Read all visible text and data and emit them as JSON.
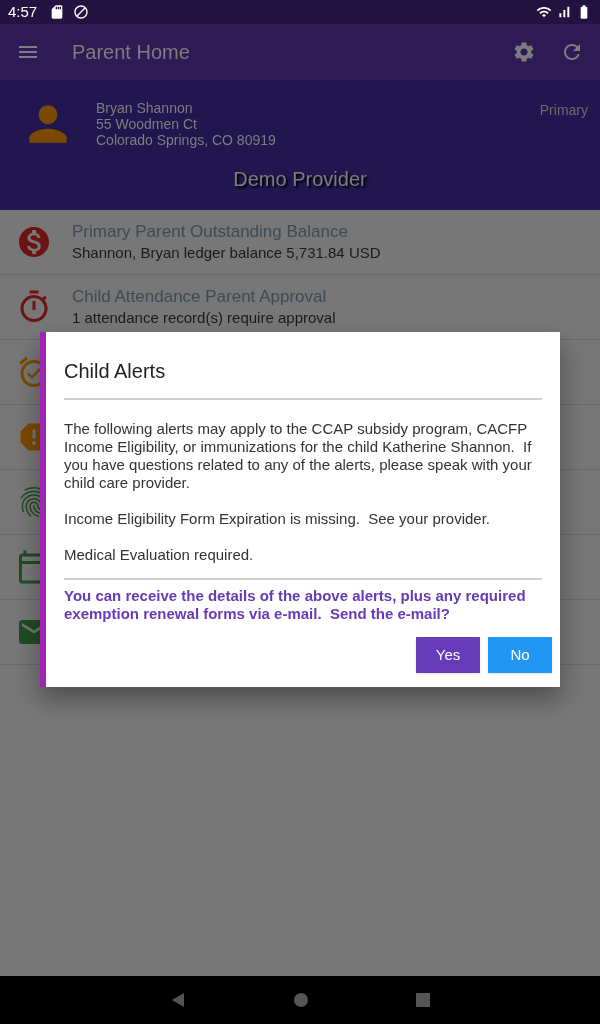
{
  "status_bar": {
    "time": "4:57"
  },
  "toolbar": {
    "title": "Parent Home"
  },
  "parent": {
    "name": "Bryan Shannon",
    "address_line_1": "55 Woodmen Ct",
    "address_line_2": "Colorado Springs, CO 80919",
    "role": "Primary"
  },
  "provider": "Demo Provider",
  "rows": [
    {
      "kind": "balance",
      "title": "Primary Parent Outstanding Balance",
      "subtitle": "Shannon, Bryan ledger balance 5,731.84 USD"
    },
    {
      "kind": "attendance",
      "title": "Child Attendance Parent Approval",
      "subtitle": "1 attendance record(s) require approval"
    },
    {
      "kind": "alarm"
    },
    {
      "kind": "alert"
    },
    {
      "kind": "fingerprint"
    },
    {
      "kind": "calendar"
    },
    {
      "kind": "mail"
    }
  ],
  "dialog": {
    "title": "Child Alerts",
    "paragraphs": [
      "The following alerts may apply to the CCAP subsidy program, CACFP Income Eligibility, or immunizations for the child Katherine Shannon.  If you have questions related to any of the alerts, please speak with your child care provider.",
      "Income Eligibility Form Expiration is missing.  See your provider.",
      "Medical Evaluation required."
    ],
    "prompt": "You can receive the details of the above alerts, plus any required exemption renewal forms via e-mail.  Send the e-mail?",
    "buttons": [
      {
        "label": "Yes",
        "kind": "primary"
      },
      {
        "label": "No",
        "kind": "secondary"
      }
    ]
  }
}
